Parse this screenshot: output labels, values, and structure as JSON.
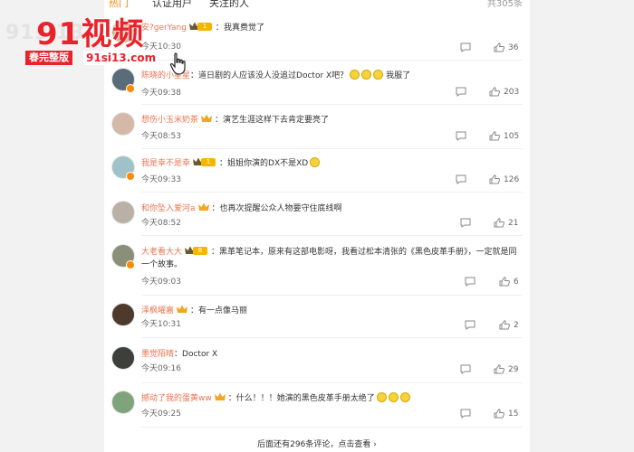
{
  "tabs": [
    {
      "label": "热门",
      "active": true
    },
    {
      "label": "认证用户",
      "active": false
    },
    {
      "label": "关注的人",
      "active": false
    }
  ],
  "total_label": "共305条",
  "comments": [
    {
      "user": "安?gerYang",
      "text": "我真费觉了",
      "time": "今天10:30",
      "likes": "36",
      "vip": "1"
    },
    {
      "user": "陈晓的小星星",
      "text": "道日剧的人应该没人没追过Doctor X吧？",
      "suffix": "我服了",
      "time": "今天09:38",
      "likes": "203"
    },
    {
      "user": "想伤小玉米奶茶",
      "text": "演艺生涯这样下去肯定要亮了",
      "time": "今天08:53",
      "likes": "105"
    },
    {
      "user": "我是幸不是幸",
      "text": "姐姐你演的DX不是XD",
      "time": "今天09:33",
      "likes": "126",
      "vip": "1"
    },
    {
      "user": "和你坠入爱河a",
      "text": "也再次提醒公众人物要守住底线啊",
      "time": "今天08:52",
      "likes": "21"
    },
    {
      "user": "大老看大大",
      "text": "黑革笔记本，原来有这部电影呀，我看过松本清张的《黑色皮革手册》，一定就是同一个故事。",
      "time": "今天09:03",
      "likes": "6",
      "vip": "8"
    },
    {
      "user": "泽枫曜嘉",
      "text": "有一点像马丽",
      "time": "今天10:31",
      "likes": "2"
    },
    {
      "user": "墨觉陌晴",
      "text": "Doctor X",
      "time": "今天09:16",
      "likes": "29"
    },
    {
      "user": "撼动了我的蛋黄ww",
      "text": "什么！！！她演的黑色皮革手册太绝了",
      "time": "今天09:25",
      "likes": "15"
    }
  ],
  "more_label": "后面还有296条评论，点击查看 ›",
  "watermark": {
    "title": "91视频",
    "bg": "91si13",
    "sub": "春完整版",
    "url": "91si13.com"
  },
  "colors": {
    "accent": "#ff8200",
    "username": "#eb7350",
    "brand_red": "#e8232b"
  }
}
